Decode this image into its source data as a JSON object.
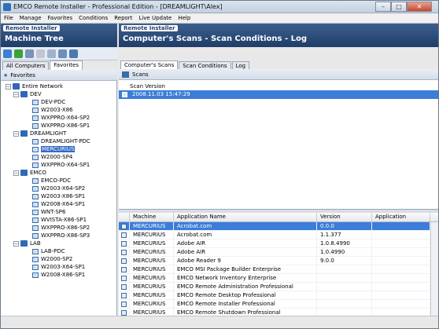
{
  "window": {
    "title": "EMCO Remote Installer - Professional Edition - [DREAMLIGHT\\Alex]"
  },
  "menu": [
    "File",
    "Manage",
    "Favorites",
    "Conditions",
    "Report",
    "Live Update",
    "Help"
  ],
  "left_panel": {
    "brand": "Remote Installer",
    "title": "Machine Tree",
    "tabs": [
      "All Computers",
      "Favorites"
    ],
    "favorites_label": "Favorites"
  },
  "right_panel": {
    "brand": "Remote Installer",
    "title": "Computer's Scans - Scan Conditions - Log",
    "tabs": [
      "Computer's Scans",
      "Scan Conditions",
      "Log"
    ],
    "scans_label": "Scans"
  },
  "tree": {
    "root": "Entire Network",
    "groups": [
      {
        "name": "DEV",
        "items": [
          "DEV-PDC",
          "W2003-X86",
          "WXPPRO-X64-SP2",
          "WXPPRO-X86-SP1"
        ]
      },
      {
        "name": "DREAMLIGHT",
        "items": [
          "DREAMLIGHT-PDC",
          "MERCURIUS",
          "W2000-SP4",
          "WXPPRO-X64-SP1"
        ]
      },
      {
        "name": "EMCO",
        "items": [
          "EMCO-PDC",
          "W2003-X64-SP2",
          "W2003-X86-SP1",
          "W2008-X64-SP1",
          "WNT-SP6",
          "WVISTA-X86-SP1",
          "WXPPRO-X86-SP2",
          "WXPPRO-X86-SP3"
        ]
      },
      {
        "name": "LAB",
        "items": [
          "LAB-PDC",
          "W2000-SP2",
          "W2003-X64-SP1",
          "W2008-X86-SP1"
        ]
      }
    ],
    "selected": "MERCURIUS"
  },
  "scans": {
    "column": "Scan Version",
    "rows": [
      "2008.11.03 15:47:29"
    ]
  },
  "apps": {
    "columns": [
      "Machine Name",
      "Application Name",
      "Version",
      "Application Comment"
    ],
    "rows": [
      [
        "MERCURIUS",
        "Acrobat.com",
        "0.0.0",
        ""
      ],
      [
        "MERCURIUS",
        "Acrobat.com",
        "1.1.377",
        ""
      ],
      [
        "MERCURIUS",
        "Adobe AIR",
        "1.0.8.4990",
        ""
      ],
      [
        "MERCURIUS",
        "Adobe AIR",
        "1.0.4990",
        ""
      ],
      [
        "MERCURIUS",
        "Adobe Reader 9",
        "9.0.0",
        ""
      ],
      [
        "MERCURIUS",
        "EMCO MSI Package Builder Enterprise",
        "",
        ""
      ],
      [
        "MERCURIUS",
        "EMCO Network Inventory Enterprise",
        "",
        ""
      ],
      [
        "MERCURIUS",
        "EMCO Remote Administration Professional",
        "",
        ""
      ],
      [
        "MERCURIUS",
        "EMCO Remote Desktop Professional",
        "",
        ""
      ],
      [
        "MERCURIUS",
        "EMCO Remote Installer Professional",
        "",
        ""
      ],
      [
        "MERCURIUS",
        "EMCO Remote Shutdown Professional",
        "",
        ""
      ]
    ]
  }
}
